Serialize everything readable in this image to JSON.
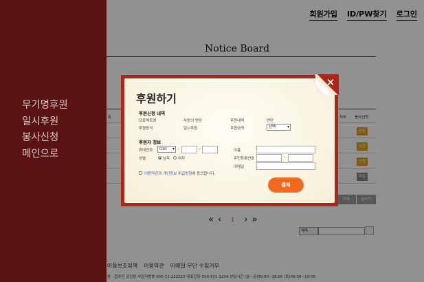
{
  "topnav": {
    "signup": "회원가입",
    "find": "ID/PW찾기",
    "login": "로그인"
  },
  "sidebar": {
    "items": [
      "무기명후원",
      "일시후원",
      "봉사신청",
      "메인으로"
    ]
  },
  "board": {
    "title": "Notice Board",
    "columns": {
      "left": "호",
      "status": "처부",
      "apply": "봉사신청"
    },
    "write_button": "쓰록",
    "list_button": "글쓰기"
  },
  "pagination": {
    "first": "«",
    "prev": "‹",
    "page": "1",
    "next": "›",
    "last": "»"
  },
  "search": {
    "field": "제목"
  },
  "footer": {
    "links": [
      "아동보호정책",
      "이용약관",
      "이메일 무단 수집거부"
    ],
    "info": "동 · 접주민 김인환   사업자번호 000-11-222222   대표전화 010-111-1234   상담시간 (월~금)09:00~18:00 (토)09:00~12:00"
  },
  "modal": {
    "title": "후원하기",
    "close": "✕",
    "section1": "후원신청 내역",
    "project_label": "프로젝트명",
    "project_value": "사랑의 연탄",
    "item_label": "후원내역",
    "item_value": "연탄",
    "method_label": "후원방식",
    "method_value": "일시후원",
    "amount_label": "후원금액",
    "amount_select": "선택",
    "section2": "후원자 정보",
    "phone_label": "휴대전화",
    "phone_prefix": "010",
    "name_label": "이름",
    "gender_label": "성별",
    "male": "남자",
    "female": "여자",
    "rrn_label": "주민등록번호",
    "email_label": "이메일",
    "terms_link": "이용약관",
    "and": "과 ",
    "privacy_link": "개인정보 취급방침",
    "agree_text": "에 동의합니다.",
    "pay": "결제"
  }
}
